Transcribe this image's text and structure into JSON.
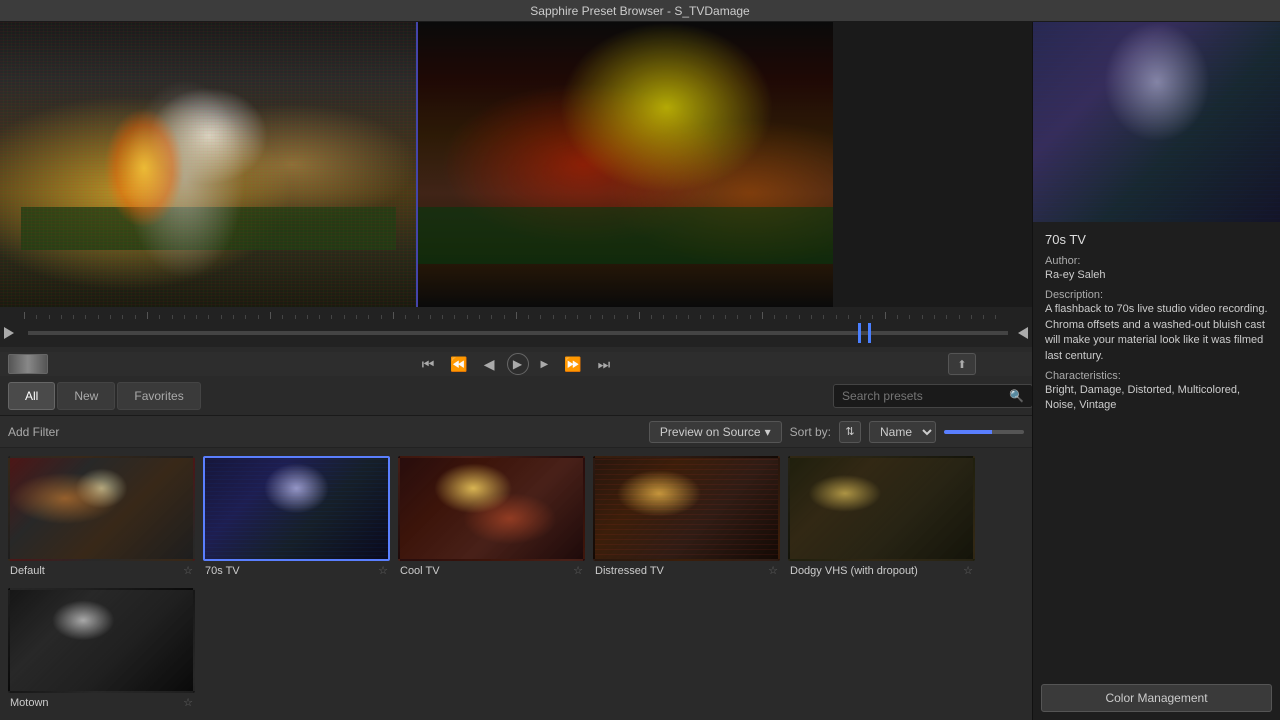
{
  "window": {
    "title": "Sapphire Preset Browser - S_TVDamage"
  },
  "tabs": {
    "all_label": "All",
    "new_label": "New",
    "favorites_label": "Favorites",
    "active": "All"
  },
  "search": {
    "placeholder": "Search presets"
  },
  "filter_bar": {
    "add_filter_label": "Add Filter",
    "preview_source_label": "Preview on Source",
    "sortby_label": "Sort by:",
    "sort_name_label": "Name"
  },
  "preset_info": {
    "title": "70s TV",
    "author_label": "Author:",
    "author_value": "Ra-ey Saleh",
    "description_label": "Description:",
    "description_value": "A flashback to 70s live studio video recording.  Chroma offsets and a washed-out bluish cast will make your material look like it was filmed last century.",
    "characteristics_label": "Characteristics:",
    "characteristics_value": "Bright, Damage, Distorted, Multicolored, Noise, Vintage"
  },
  "color_management": {
    "label": "Color Management"
  },
  "thumbnails": [
    {
      "id": "default",
      "label": "Default",
      "selected": false,
      "style": "thumb-default"
    },
    {
      "id": "70stv",
      "label": "70s TV",
      "selected": true,
      "style": "thumb-70stv"
    },
    {
      "id": "cooltv",
      "label": "Cool TV",
      "selected": false,
      "style": "thumb-cooltv"
    },
    {
      "id": "distressed",
      "label": "Distressed TV",
      "selected": false,
      "style": "thumb-distressed"
    },
    {
      "id": "dodgyvhs",
      "label": "Dodgy VHS (with dropout)",
      "selected": false,
      "style": "thumb-dodgyvhs"
    },
    {
      "id": "motown",
      "label": "Motown",
      "selected": false,
      "style": "thumb-motown"
    }
  ],
  "transport": {
    "skip_back": "⏮",
    "step_back": "⏪",
    "back": "◀",
    "play": "▶",
    "forward": "▶",
    "step_forward": "⏩",
    "skip_forward": "⏭"
  }
}
